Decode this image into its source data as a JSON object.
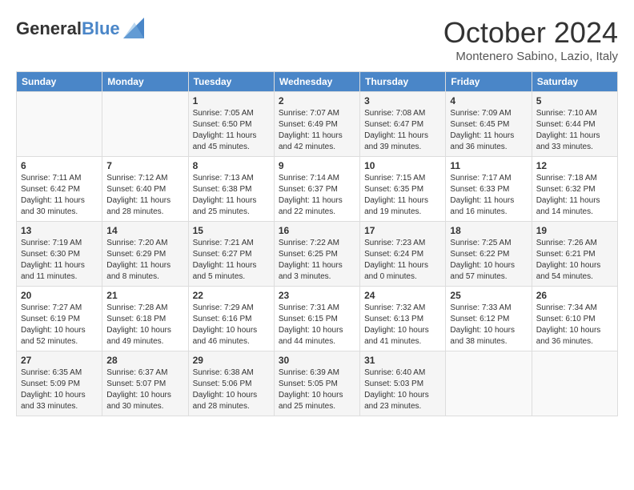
{
  "header": {
    "logo_line1": "General",
    "logo_line2": "Blue",
    "month_title": "October 2024",
    "subtitle": "Montenero Sabino, Lazio, Italy"
  },
  "days_of_week": [
    "Sunday",
    "Monday",
    "Tuesday",
    "Wednesday",
    "Thursday",
    "Friday",
    "Saturday"
  ],
  "weeks": [
    [
      {
        "day": "",
        "sunrise": "",
        "sunset": "",
        "daylight": ""
      },
      {
        "day": "",
        "sunrise": "",
        "sunset": "",
        "daylight": ""
      },
      {
        "day": "1",
        "sunrise": "Sunrise: 7:05 AM",
        "sunset": "Sunset: 6:50 PM",
        "daylight": "Daylight: 11 hours and 45 minutes."
      },
      {
        "day": "2",
        "sunrise": "Sunrise: 7:07 AM",
        "sunset": "Sunset: 6:49 PM",
        "daylight": "Daylight: 11 hours and 42 minutes."
      },
      {
        "day": "3",
        "sunrise": "Sunrise: 7:08 AM",
        "sunset": "Sunset: 6:47 PM",
        "daylight": "Daylight: 11 hours and 39 minutes."
      },
      {
        "day": "4",
        "sunrise": "Sunrise: 7:09 AM",
        "sunset": "Sunset: 6:45 PM",
        "daylight": "Daylight: 11 hours and 36 minutes."
      },
      {
        "day": "5",
        "sunrise": "Sunrise: 7:10 AM",
        "sunset": "Sunset: 6:44 PM",
        "daylight": "Daylight: 11 hours and 33 minutes."
      }
    ],
    [
      {
        "day": "6",
        "sunrise": "Sunrise: 7:11 AM",
        "sunset": "Sunset: 6:42 PM",
        "daylight": "Daylight: 11 hours and 30 minutes."
      },
      {
        "day": "7",
        "sunrise": "Sunrise: 7:12 AM",
        "sunset": "Sunset: 6:40 PM",
        "daylight": "Daylight: 11 hours and 28 minutes."
      },
      {
        "day": "8",
        "sunrise": "Sunrise: 7:13 AM",
        "sunset": "Sunset: 6:38 PM",
        "daylight": "Daylight: 11 hours and 25 minutes."
      },
      {
        "day": "9",
        "sunrise": "Sunrise: 7:14 AM",
        "sunset": "Sunset: 6:37 PM",
        "daylight": "Daylight: 11 hours and 22 minutes."
      },
      {
        "day": "10",
        "sunrise": "Sunrise: 7:15 AM",
        "sunset": "Sunset: 6:35 PM",
        "daylight": "Daylight: 11 hours and 19 minutes."
      },
      {
        "day": "11",
        "sunrise": "Sunrise: 7:17 AM",
        "sunset": "Sunset: 6:33 PM",
        "daylight": "Daylight: 11 hours and 16 minutes."
      },
      {
        "day": "12",
        "sunrise": "Sunrise: 7:18 AM",
        "sunset": "Sunset: 6:32 PM",
        "daylight": "Daylight: 11 hours and 14 minutes."
      }
    ],
    [
      {
        "day": "13",
        "sunrise": "Sunrise: 7:19 AM",
        "sunset": "Sunset: 6:30 PM",
        "daylight": "Daylight: 11 hours and 11 minutes."
      },
      {
        "day": "14",
        "sunrise": "Sunrise: 7:20 AM",
        "sunset": "Sunset: 6:29 PM",
        "daylight": "Daylight: 11 hours and 8 minutes."
      },
      {
        "day": "15",
        "sunrise": "Sunrise: 7:21 AM",
        "sunset": "Sunset: 6:27 PM",
        "daylight": "Daylight: 11 hours and 5 minutes."
      },
      {
        "day": "16",
        "sunrise": "Sunrise: 7:22 AM",
        "sunset": "Sunset: 6:25 PM",
        "daylight": "Daylight: 11 hours and 3 minutes."
      },
      {
        "day": "17",
        "sunrise": "Sunrise: 7:23 AM",
        "sunset": "Sunset: 6:24 PM",
        "daylight": "Daylight: 11 hours and 0 minutes."
      },
      {
        "day": "18",
        "sunrise": "Sunrise: 7:25 AM",
        "sunset": "Sunset: 6:22 PM",
        "daylight": "Daylight: 10 hours and 57 minutes."
      },
      {
        "day": "19",
        "sunrise": "Sunrise: 7:26 AM",
        "sunset": "Sunset: 6:21 PM",
        "daylight": "Daylight: 10 hours and 54 minutes."
      }
    ],
    [
      {
        "day": "20",
        "sunrise": "Sunrise: 7:27 AM",
        "sunset": "Sunset: 6:19 PM",
        "daylight": "Daylight: 10 hours and 52 minutes."
      },
      {
        "day": "21",
        "sunrise": "Sunrise: 7:28 AM",
        "sunset": "Sunset: 6:18 PM",
        "daylight": "Daylight: 10 hours and 49 minutes."
      },
      {
        "day": "22",
        "sunrise": "Sunrise: 7:29 AM",
        "sunset": "Sunset: 6:16 PM",
        "daylight": "Daylight: 10 hours and 46 minutes."
      },
      {
        "day": "23",
        "sunrise": "Sunrise: 7:31 AM",
        "sunset": "Sunset: 6:15 PM",
        "daylight": "Daylight: 10 hours and 44 minutes."
      },
      {
        "day": "24",
        "sunrise": "Sunrise: 7:32 AM",
        "sunset": "Sunset: 6:13 PM",
        "daylight": "Daylight: 10 hours and 41 minutes."
      },
      {
        "day": "25",
        "sunrise": "Sunrise: 7:33 AM",
        "sunset": "Sunset: 6:12 PM",
        "daylight": "Daylight: 10 hours and 38 minutes."
      },
      {
        "day": "26",
        "sunrise": "Sunrise: 7:34 AM",
        "sunset": "Sunset: 6:10 PM",
        "daylight": "Daylight: 10 hours and 36 minutes."
      }
    ],
    [
      {
        "day": "27",
        "sunrise": "Sunrise: 6:35 AM",
        "sunset": "Sunset: 5:09 PM",
        "daylight": "Daylight: 10 hours and 33 minutes."
      },
      {
        "day": "28",
        "sunrise": "Sunrise: 6:37 AM",
        "sunset": "Sunset: 5:07 PM",
        "daylight": "Daylight: 10 hours and 30 minutes."
      },
      {
        "day": "29",
        "sunrise": "Sunrise: 6:38 AM",
        "sunset": "Sunset: 5:06 PM",
        "daylight": "Daylight: 10 hours and 28 minutes."
      },
      {
        "day": "30",
        "sunrise": "Sunrise: 6:39 AM",
        "sunset": "Sunset: 5:05 PM",
        "daylight": "Daylight: 10 hours and 25 minutes."
      },
      {
        "day": "31",
        "sunrise": "Sunrise: 6:40 AM",
        "sunset": "Sunset: 5:03 PM",
        "daylight": "Daylight: 10 hours and 23 minutes."
      },
      {
        "day": "",
        "sunrise": "",
        "sunset": "",
        "daylight": ""
      },
      {
        "day": "",
        "sunrise": "",
        "sunset": "",
        "daylight": ""
      }
    ]
  ]
}
